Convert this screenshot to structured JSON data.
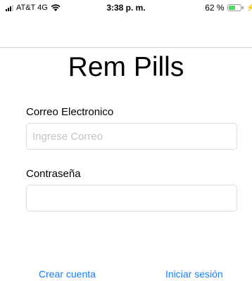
{
  "status_bar": {
    "carrier": "AT&T 4G",
    "time": "3:38 p. m.",
    "battery_percent": "62 %",
    "battery_level": 0.62,
    "battery_color": "#4cd964",
    "signal_icon": "cellular-signal-icon",
    "wifi_icon": "wifi-icon",
    "battery_icon": "battery-icon",
    "charging_icon": "charging-bolt-icon"
  },
  "title": "Rem Pills",
  "email": {
    "label": "Correo Electronico",
    "placeholder": "Ingrese Correo",
    "value": ""
  },
  "password": {
    "label": "Contraseña",
    "placeholder": "",
    "value": ""
  },
  "actions": {
    "create_account": "Crear cuenta",
    "login": "Iniciar sesión",
    "link_color": "#147efb"
  }
}
